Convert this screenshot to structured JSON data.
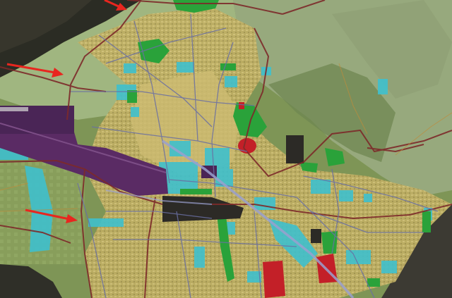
{
  "map": {
    "colors": {
      "mountain_dark": "#2d2d26",
      "mountain_mid": "#4b5238",
      "hill_overlay": "#9cae83",
      "valley_overlay": "#8da562",
      "urban_yellow": "#b9a960",
      "urban_dense": "#cbb96b",
      "industrial_cyan": "#3fc2cf",
      "green_space": "#2fa836",
      "airport_purple": "#5a2a63",
      "red_zone": "#c42027",
      "dark_zone": "#2b2a26",
      "road_major": "#8a2a2a",
      "road_minor": "#6a6fa8",
      "rail": "#8d94c8",
      "arrow_red": "#e8261f"
    },
    "arrows": [
      {
        "name": "arrow-top"
      },
      {
        "name": "arrow-left"
      },
      {
        "name": "arrow-bottom"
      }
    ]
  }
}
